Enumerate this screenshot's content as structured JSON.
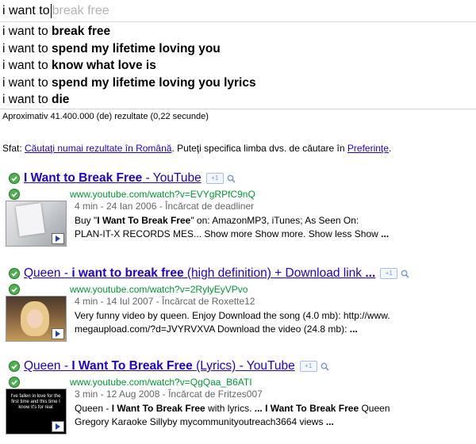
{
  "search": {
    "typed": "i want to",
    "completion": "break free"
  },
  "suggestions": [
    {
      "prefix": "i want to ",
      "bold": "break free"
    },
    {
      "prefix": "i want to ",
      "bold": "spend my lifetime loving you"
    },
    {
      "prefix": "i want to ",
      "bold": "know what love is"
    },
    {
      "prefix": "i want to ",
      "bold": "spend my lifetime loving you lyrics"
    },
    {
      "prefix": "i want to ",
      "bold": "die"
    }
  ],
  "stats": "Aproximativ 41.400.000 (de) rezultate (0,22 secunde)",
  "tip": {
    "prefix": "Sfat: ",
    "link1": "Căutaţi numai rezultate în Română",
    "middle": ". Puteţi specifica limba dvs. de căutare în ",
    "link2": "Preferinţe",
    "suffix": "."
  },
  "results": [
    {
      "title_parts": [
        {
          "t": "I Want to Break Free",
          "b": true
        },
        {
          "t": " - YouTube",
          "b": false
        }
      ],
      "url": "www.youtube.com/watch?v=EVYgRPfC9nQ",
      "meta": "4 min - 24 Ian 2006 - Încărcat de deadliner",
      "snippet1_parts": [
        {
          "t": "Buy \"",
          "b": false
        },
        {
          "t": "I Want To Break Free",
          "b": true
        },
        {
          "t": "\" on: AmazonMP3, iTunes; As Seen On:",
          "b": false
        }
      ],
      "snippet2_parts": [
        {
          "t": "PLAN-IT-X RECORDS MES... Show more Show more. Show less Show ",
          "b": false
        },
        {
          "t": "...",
          "b": true
        }
      ]
    },
    {
      "title_parts": [
        {
          "t": "Queen - ",
          "b": false
        },
        {
          "t": "i want to break free",
          "b": true
        },
        {
          "t": " (high definition) + Download link ",
          "b": false
        },
        {
          "t": "...",
          "b": true
        }
      ],
      "url": "www.youtube.com/watch?v=2RylyEyVPvo",
      "meta": "4 min - 14 Iul 2007 - Încărcat de Roxette12",
      "snippet1_parts": [
        {
          "t": "Very funny video by queen. Enjoy Download the song (4.0 mb): http://www.",
          "b": false
        }
      ],
      "snippet2_parts": [
        {
          "t": "megaupload.com/?d=JVYRVXVA Download the video (24.8 mb): ",
          "b": false
        },
        {
          "t": "...",
          "b": true
        }
      ]
    },
    {
      "title_parts": [
        {
          "t": "Queen - ",
          "b": false
        },
        {
          "t": "I Want To Break Free",
          "b": true
        },
        {
          "t": " (Lyrics) - YouTube",
          "b": false
        }
      ],
      "url": "www.youtube.com/watch?v=QgQaa_B6ATI",
      "meta": "3 min - 12 Aug 2008 - Încărcat de Fritzes007",
      "snippet1_parts": [
        {
          "t": "Queen - ",
          "b": false
        },
        {
          "t": "I Want To Break Free",
          "b": true
        },
        {
          "t": " with lyrics. ",
          "b": false
        },
        {
          "t": "... I Want To Break Free",
          "b": true
        },
        {
          "t": " Queen",
          "b": false
        }
      ],
      "snippet2_parts": [
        {
          "t": "Gregory Karaoke Sillyby mycommunityoutreach3664 views ",
          "b": false
        },
        {
          "t": "...",
          "b": true
        }
      ],
      "thumb_text": "I've fallen in love for the first time and this time I know it's for real"
    }
  ],
  "plusone_label": "+1"
}
